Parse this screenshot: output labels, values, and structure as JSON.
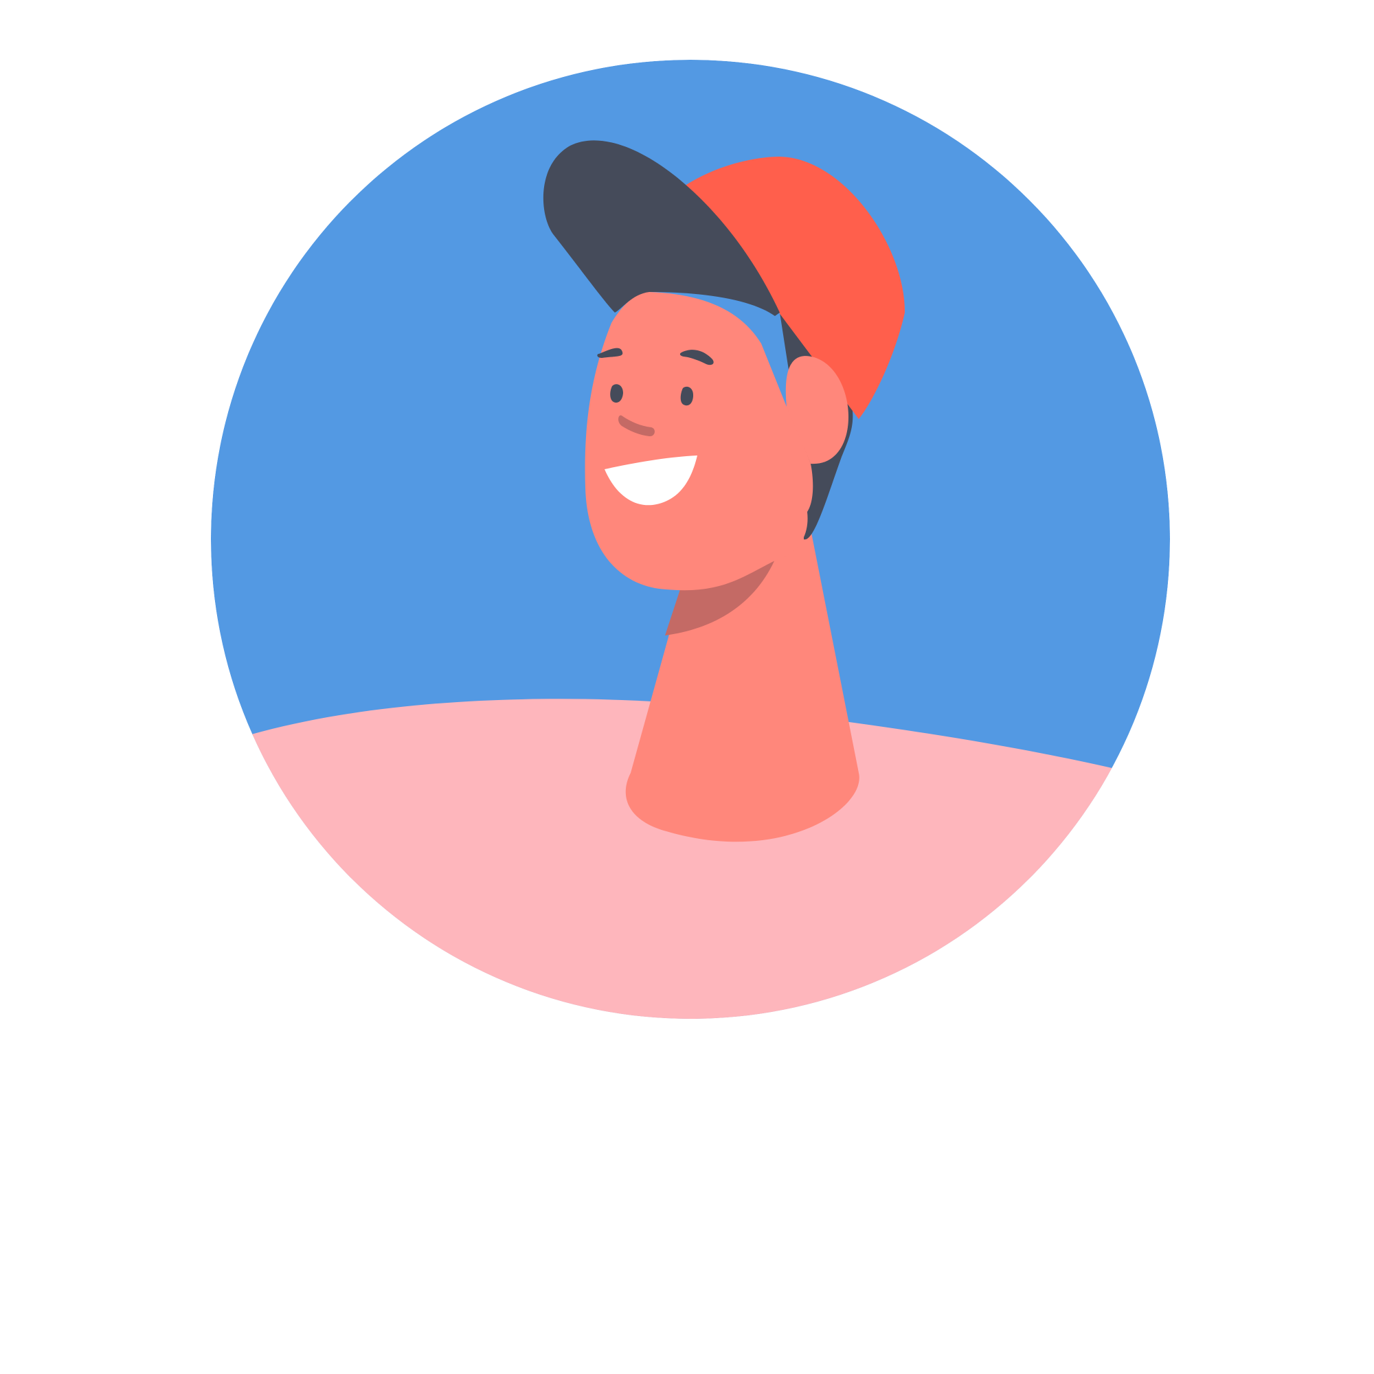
{
  "avatar": {
    "description_icon": "avatar-person-cap-icon",
    "colors": {
      "page_background": "#ffffff",
      "sky": "#5399e3",
      "shirt": "#feb6bc",
      "skin": "#ff877b",
      "skin_shadow": "#c46a65",
      "hair": "#454b5a",
      "cap": "#ff5f4c",
      "teeth": "#ffffff",
      "features": "#454b5a"
    }
  }
}
